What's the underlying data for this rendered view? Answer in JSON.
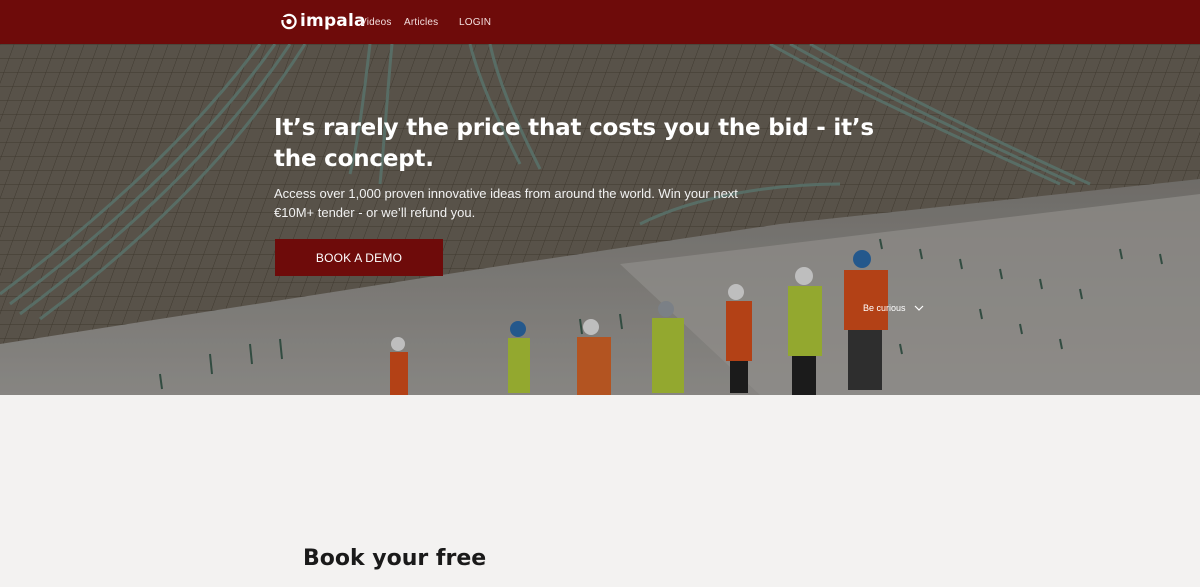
{
  "header": {
    "brand": "impala",
    "nav": {
      "videos": "Videos",
      "articles": "Articles",
      "login": "LOGIN"
    }
  },
  "hero": {
    "heading": "It’s rarely the price that costs you the bid - it’s the concept.",
    "subtext": "Access over 1,000 proven innovative ideas from around the world. Win your next €10M+ tender - or we’ll refund you.",
    "cta_label": "BOOK A DEMO",
    "scroll_hint": "Be curious",
    "background_image": "construction-site-workers-photo"
  },
  "section": {
    "title": "Book your free"
  },
  "colors": {
    "brand": "#6e0b0a",
    "page_background": "#f3f2f1",
    "heading_text": "#1a1a1a"
  },
  "icons": {
    "logo": "impala-logo-icon",
    "scroll": "chevron-down-icon"
  }
}
